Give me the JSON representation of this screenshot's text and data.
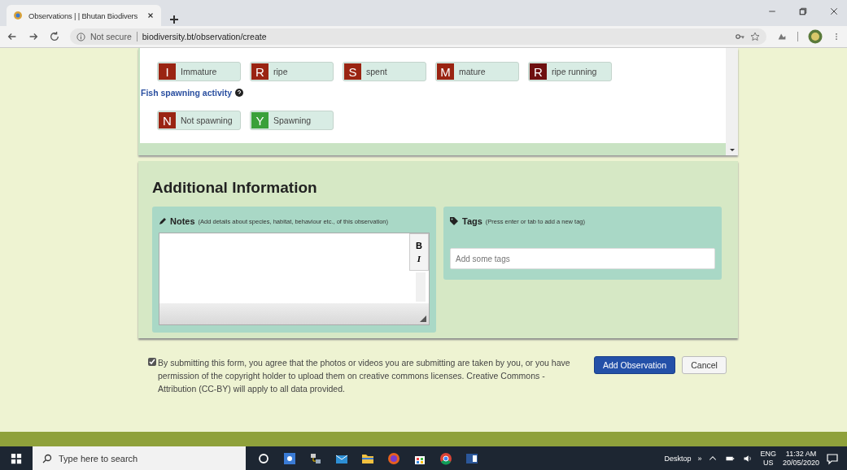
{
  "browser": {
    "tab_title": "Observations | | Bhutan Biodivers",
    "secure_label": "Not secure",
    "url": "biodiversity.bt/observation/create"
  },
  "maturity_options": [
    {
      "letter": "I",
      "label": "Immature",
      "color": "#9a2412"
    },
    {
      "letter": "R",
      "label": "ripe",
      "color": "#9a2412"
    },
    {
      "letter": "S",
      "label": "spent",
      "color": "#9a2412"
    },
    {
      "letter": "M",
      "label": "mature",
      "color": "#9a2412"
    },
    {
      "letter": "R",
      "label": "ripe running",
      "color": "#6e1010"
    }
  ],
  "spawning": {
    "label": "Fish spawning activity",
    "options": [
      {
        "letter": "N",
        "label": "Not spawning",
        "color": "#9a2412"
      },
      {
        "letter": "Y",
        "label": "Spawning",
        "color": "#3aa03a"
      }
    ]
  },
  "additional": {
    "title": "Additional Information",
    "notes": {
      "label": "Notes",
      "hint": "(Add details about species, habitat, behaviour etc., of this observation)",
      "bold": "B",
      "italic": "I"
    },
    "tags": {
      "label": "Tags",
      "hint": "(Press enter or tab to add a new tag)",
      "placeholder": "Add some tags"
    }
  },
  "agreement": {
    "checked": true,
    "text": "By submitting this form, you agree that the photos or videos you are submitting are taken by you, or you have permission of the copyright holder to upload them on creative commons licenses. Creative Commons - Attribution (CC-BY) will apply to all data provided."
  },
  "buttons": [
    {
      "label": "Add Observation",
      "kind": "primary"
    },
    {
      "label": "Cancel",
      "kind": "default"
    }
  ],
  "taskbar": {
    "search_placeholder": "Type here to search",
    "desktop_label": "Desktop",
    "overflow": "»",
    "lang": "ENG",
    "region": "US",
    "time": "11:32 AM",
    "date": "20/05/2020"
  }
}
